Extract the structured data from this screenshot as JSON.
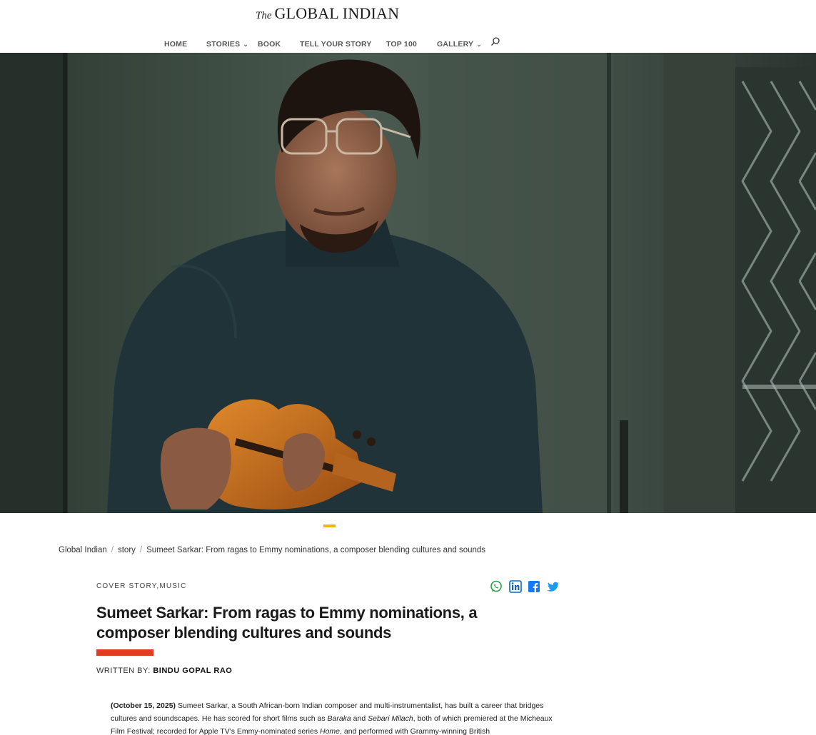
{
  "header": {
    "logo_prefix": "The",
    "logo_name": "GLOBAL INDIAN"
  },
  "nav": {
    "items": [
      {
        "label": "HOME",
        "has_dropdown": false
      },
      {
        "label": "STORIES",
        "has_dropdown": true
      },
      {
        "label": "BOOK",
        "has_dropdown": false
      },
      {
        "label": "TELL YOUR STORY",
        "has_dropdown": false
      },
      {
        "label": "TOP 100",
        "has_dropdown": false
      },
      {
        "label": "GALLERY",
        "has_dropdown": true
      }
    ],
    "search_icon": "search-icon",
    "chevron_icon": "chevron-down-icon"
  },
  "hero": {
    "icon": "hero-photo-man-with-violin",
    "slide_indicator_color": "#f0b418"
  },
  "breadcrumb": {
    "items": [
      "Global Indian",
      "story",
      "Sumeet Sarkar: From ragas to Emmy nominations, a composer blending cultures and sounds"
    ],
    "separator": "/"
  },
  "article": {
    "categories": [
      "COVER STORY",
      "MUSIC"
    ],
    "category_separator": ",",
    "title": "Sumeet Sarkar: From ragas to Emmy nominations, a composer blending cultures and sounds",
    "accent_color": "#e23c1f",
    "byline_label": "WRITTEN BY:",
    "author": "BINDU GOPAL RAO",
    "share": [
      {
        "icon": "whatsapp-icon",
        "color": "#25a244"
      },
      {
        "icon": "linkedin-icon",
        "color": "#0a66c2"
      },
      {
        "icon": "facebook-icon",
        "color": "#1877f2"
      },
      {
        "icon": "twitter-icon",
        "color": "#1d9bf0"
      }
    ],
    "body": {
      "date": "(October 15, 2025)",
      "text_1": " Sumeet Sarkar, a South African-born Indian composer and multi-instrumentalist, has built a career that bridges cultures and soundscapes. He has scored for short films such as ",
      "film_1": "Baraka",
      "text_2": " and ",
      "film_2": "Sebari Milach",
      "text_3": ", both of which premiered at the Micheaux Film Festival; recorded for Apple TV's Emmy-nominated series ",
      "series": "Home",
      "text_4": ", and performed with Grammy-winning British"
    }
  }
}
